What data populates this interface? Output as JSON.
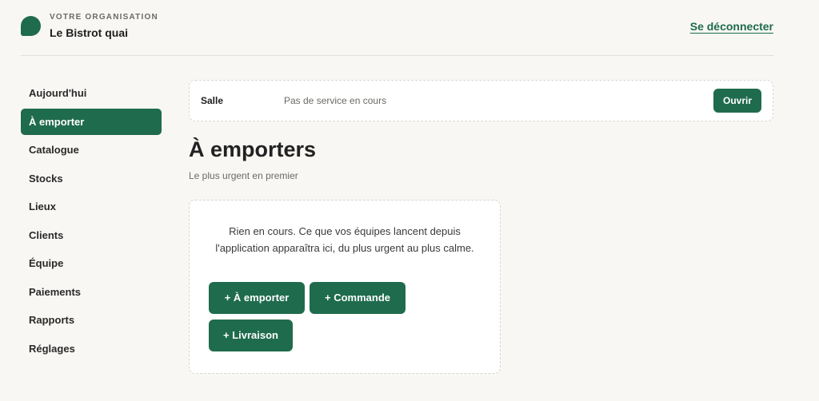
{
  "header": {
    "org_label": "VOTRE ORGANISATION",
    "org_name": "Le Bistrot quai",
    "logout_label": "Se déconnecter",
    "brand_color": "#1f6b4e"
  },
  "nav": {
    "items": [
      {
        "label": "Aujourd'hui",
        "active": false
      },
      {
        "label": "À emporter",
        "active": true
      },
      {
        "label": "Catalogue",
        "active": false
      },
      {
        "label": "Stocks",
        "active": false
      },
      {
        "label": "Lieux",
        "active": false
      },
      {
        "label": "Clients",
        "active": false
      },
      {
        "label": "Équipe",
        "active": false
      },
      {
        "label": "Paiements",
        "active": false
      },
      {
        "label": "Rapports",
        "active": false
      },
      {
        "label": "Réglages",
        "active": false
      }
    ]
  },
  "salle": {
    "label": "Salle",
    "status": "Pas de service en cours",
    "open_label": "Ouvrir"
  },
  "main": {
    "title": "À emporters",
    "subtitle": "Le plus urgent en premier",
    "empty_text": "Rien en cours. Ce que vos équipes lancent depuis l'application apparaîtra ici, du plus urgent au plus calme.",
    "actions": {
      "emporter": "+ À emporter",
      "commande": "+ Commande",
      "livraison": "+ Livraison"
    }
  }
}
